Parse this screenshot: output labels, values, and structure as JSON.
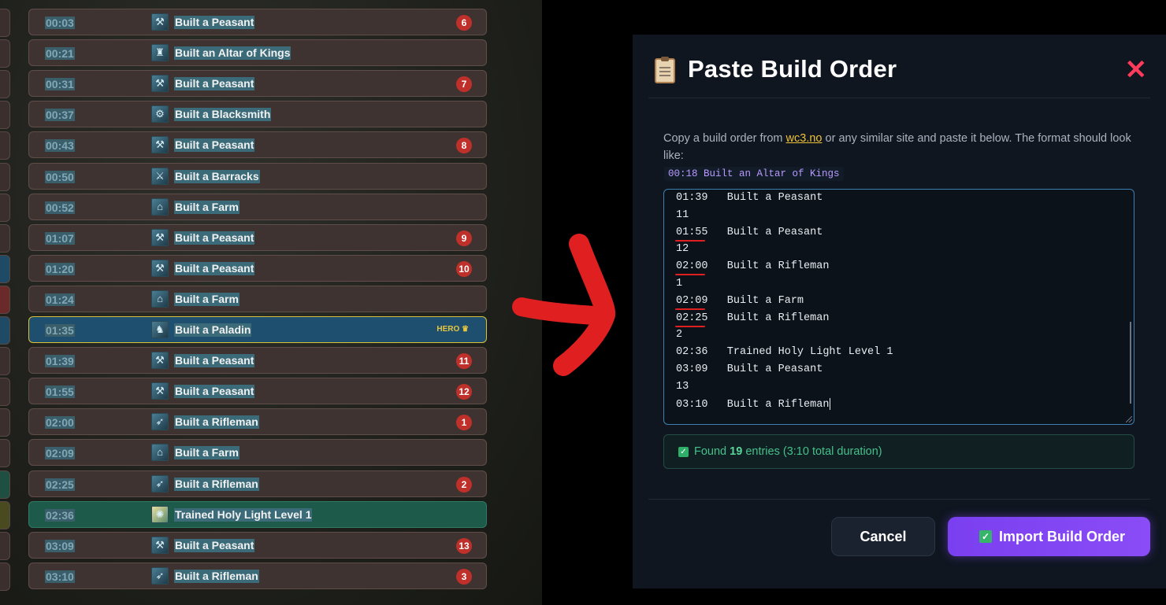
{
  "left_panel": {
    "rows": [
      {
        "time": "00:03",
        "label": "Built a Peasant",
        "badge": "6",
        "type": "normal",
        "icon": "peasant-icon"
      },
      {
        "time": "00:21",
        "label": "Built an Altar of Kings",
        "badge": "",
        "type": "normal",
        "icon": "altar-icon"
      },
      {
        "time": "00:31",
        "label": "Built a Peasant",
        "badge": "7",
        "type": "normal",
        "icon": "peasant-icon"
      },
      {
        "time": "00:37",
        "label": "Built a Blacksmith",
        "badge": "",
        "type": "normal",
        "icon": "blacksmith-icon"
      },
      {
        "time": "00:43",
        "label": "Built a Peasant",
        "badge": "8",
        "type": "normal",
        "icon": "peasant-icon"
      },
      {
        "time": "00:50",
        "label": "Built a Barracks",
        "badge": "",
        "type": "normal",
        "icon": "barracks-icon"
      },
      {
        "time": "00:52",
        "label": "Built a Farm",
        "badge": "",
        "type": "normal",
        "icon": "farm-icon"
      },
      {
        "time": "01:07",
        "label": "Built a Peasant",
        "badge": "9",
        "type": "normal",
        "icon": "peasant-icon"
      },
      {
        "time": "01:20",
        "label": "Built a Peasant",
        "badge": "10",
        "type": "normal",
        "icon": "peasant-icon"
      },
      {
        "time": "01:24",
        "label": "Built a Farm",
        "badge": "",
        "type": "normal",
        "icon": "farm-icon"
      },
      {
        "time": "01:35",
        "label": "Built a Paladin",
        "badge": "",
        "type": "hero",
        "hero_tag": "HERO ♛",
        "icon": "paladin-icon"
      },
      {
        "time": "01:39",
        "label": "Built a Peasant",
        "badge": "11",
        "type": "normal",
        "icon": "peasant-icon"
      },
      {
        "time": "01:55",
        "label": "Built a Peasant",
        "badge": "12",
        "type": "normal",
        "icon": "peasant-icon"
      },
      {
        "time": "02:00",
        "label": "Built a Rifleman",
        "badge": "1",
        "type": "normal",
        "icon": "rifleman-icon"
      },
      {
        "time": "02:09",
        "label": "Built a Farm",
        "badge": "",
        "type": "normal",
        "icon": "farm-icon"
      },
      {
        "time": "02:25",
        "label": "Built a Rifleman",
        "badge": "2",
        "type": "normal",
        "icon": "rifleman-icon"
      },
      {
        "time": "02:36",
        "label": "Trained Holy Light Level 1",
        "badge": "",
        "type": "research",
        "icon": "holy-light-icon"
      },
      {
        "time": "03:09",
        "label": "Built a Peasant",
        "badge": "13",
        "type": "normal",
        "icon": "peasant-icon"
      },
      {
        "time": "03:10",
        "label": "Built a Rifleman",
        "badge": "3",
        "type": "normal",
        "icon": "rifleman-icon"
      }
    ],
    "strip_colors": [
      "#3a2f2d",
      "#3a2f2d",
      "#3a2f2d",
      "#3a2f2d",
      "#3a2f2d",
      "#3a2f2d",
      "#3a2f2d",
      "#3a2f2d",
      "#1f4a66",
      "#6a2a2a",
      "#1f4a66",
      "#3a2f2d",
      "#3a2f2d",
      "#3a2f2d",
      "#3a2f2d",
      "#1f4f40",
      "#4a4a20",
      "#3a2f2d",
      "#3a2f2d"
    ]
  },
  "modal": {
    "icon": "clipboard-icon",
    "title": "Paste Build Order",
    "close_label": "✕",
    "description_before": "Copy a build order from ",
    "description_link": "wc3.no",
    "description_after": " or any similar site and paste it below. The format should look like:",
    "example": "00:18 Built an Altar of Kings",
    "textarea_lines": [
      "01:39   Built a Peasant",
      "11",
      "01:55   Built a Peasant",
      "12",
      "02:00   Built a Rifleman",
      "1",
      "02:09   Built a Farm",
      "02:25   Built a Rifleman",
      "2",
      "02:36   Trained Holy Light Level 1",
      "03:09   Built a Peasant",
      "13",
      "03:10   Built a Rifleman"
    ],
    "found_prefix": "Found ",
    "found_count": "19",
    "found_suffix": " entries (3:10 total duration)",
    "cancel_label": "Cancel",
    "import_label": "Import Build Order"
  },
  "colors": {
    "accent_purple": "#7a3ff0",
    "close_red": "#ff3b5c",
    "success_green": "#46c08a",
    "link_yellow": "#f0c23a",
    "annotation_red": "#e02020"
  }
}
